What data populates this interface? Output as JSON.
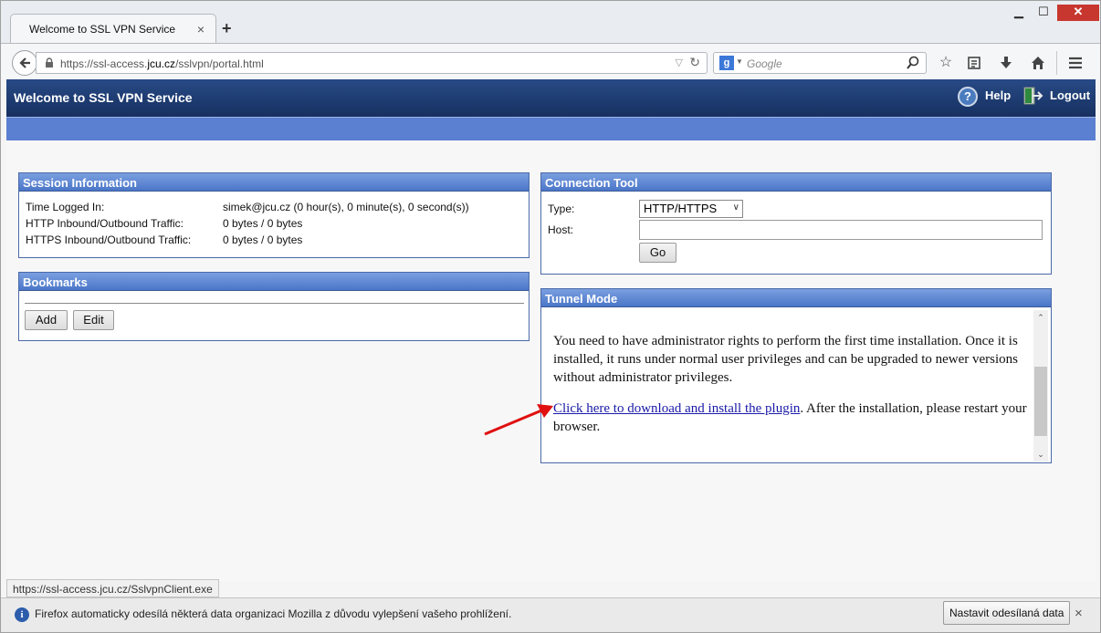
{
  "browser": {
    "tab_title": "Welcome to SSL VPN Service",
    "tab_close": "×",
    "new_tab": "+",
    "url_prefix": "https://ssl-access.",
    "url_domain": "jcu.cz",
    "url_path": "/sslvpn/portal.html",
    "search_placeholder": "Google",
    "search_engine_letter": "g",
    "window_controls": {
      "minimize": "▁",
      "maximize": "☐",
      "close": "✕"
    },
    "icons": [
      "bookmark-star-icon",
      "reading-list-icon",
      "download-icon",
      "home-icon",
      "menu-icon"
    ]
  },
  "app": {
    "title": "Welcome to SSL VPN Service",
    "help_label": "Help",
    "help_glyph": "?",
    "logout_label": "Logout",
    "colors": {
      "header": "#1e3a6e",
      "strip": "#5b7fd1",
      "panel_head": "#5a83d0"
    }
  },
  "session": {
    "heading": "Session Information",
    "rows": [
      {
        "label": "Time Logged In:",
        "value": "simek@jcu.cz (0 hour(s), 0 minute(s), 0 second(s))"
      },
      {
        "label": "HTTP Inbound/Outbound Traffic:",
        "value": "0 bytes / 0 bytes"
      },
      {
        "label": "HTTPS Inbound/Outbound Traffic:",
        "value": "0 bytes / 0 bytes"
      }
    ]
  },
  "bookmarks": {
    "heading": "Bookmarks",
    "add_label": "Add",
    "edit_label": "Edit"
  },
  "connection": {
    "heading": "Connection Tool",
    "type_label": "Type:",
    "type_value": "HTTP/HTTPS",
    "host_label": "Host:",
    "host_value": "",
    "go_label": "Go"
  },
  "tunnel": {
    "heading": "Tunnel Mode",
    "paragraph1": "You need to have administrator rights to perform the first time installation. Once it is installed, it runs under normal user privileges and can be upgraded to newer versions without administrator privileges.",
    "link_text": "Click here to download and install the plugin",
    "paragraph2_rest": ". After the installation, please restart your browser."
  },
  "status": {
    "link_url": "https://ssl-access.jcu.cz/SslvpnClient.exe"
  },
  "notification": {
    "text": "Firefox automaticky odesílá některá data organizaci Mozilla z důvodu vylepšení vašeho prohlížení.",
    "button_label": "Nastavit odesílaná data",
    "close": "×",
    "info_glyph": "i"
  }
}
